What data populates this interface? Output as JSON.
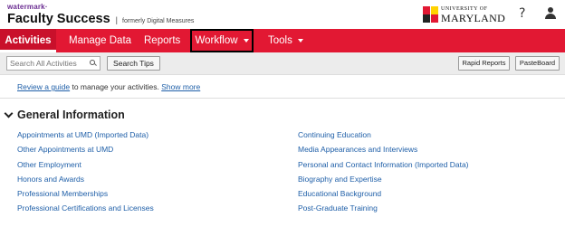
{
  "header": {
    "brand_small": "watermark·",
    "brand_name": "Faculty Success",
    "brand_sep": "|",
    "brand_former": "formerly Digital Measures",
    "university_top": "UNIVERSITY OF",
    "university_bottom": "MARYLAND",
    "help_icon": "?"
  },
  "nav": {
    "activities": "Activities",
    "manage_data": "Manage Data",
    "reports": "Reports",
    "workflow": "Workflow",
    "tools": "Tools"
  },
  "toolbar": {
    "search_placeholder": "Search All Activities",
    "search_tips": "Search Tips",
    "rapid_reports": "Rapid Reports",
    "pasteboard": "PasteBoard"
  },
  "guide": {
    "link": "Review a guide",
    "text": " to manage your activities. ",
    "show_more": "Show more"
  },
  "section": {
    "title": "General Information",
    "left_links": [
      "Appointments at UMD (Imported Data)",
      "Other Appointments at UMD",
      "Other Employment",
      "Honors and Awards",
      "Professional Memberships",
      "Professional Certifications and Licenses"
    ],
    "right_links": [
      "Continuing Education",
      "Media Appearances and Interviews",
      "Personal and Contact Information (Imported Data)",
      "Biography and Expertise",
      "Educational Background",
      "Post-Graduate Training"
    ]
  },
  "colors": {
    "brand_red": "#e21833",
    "link_blue": "#1f5fa8"
  }
}
